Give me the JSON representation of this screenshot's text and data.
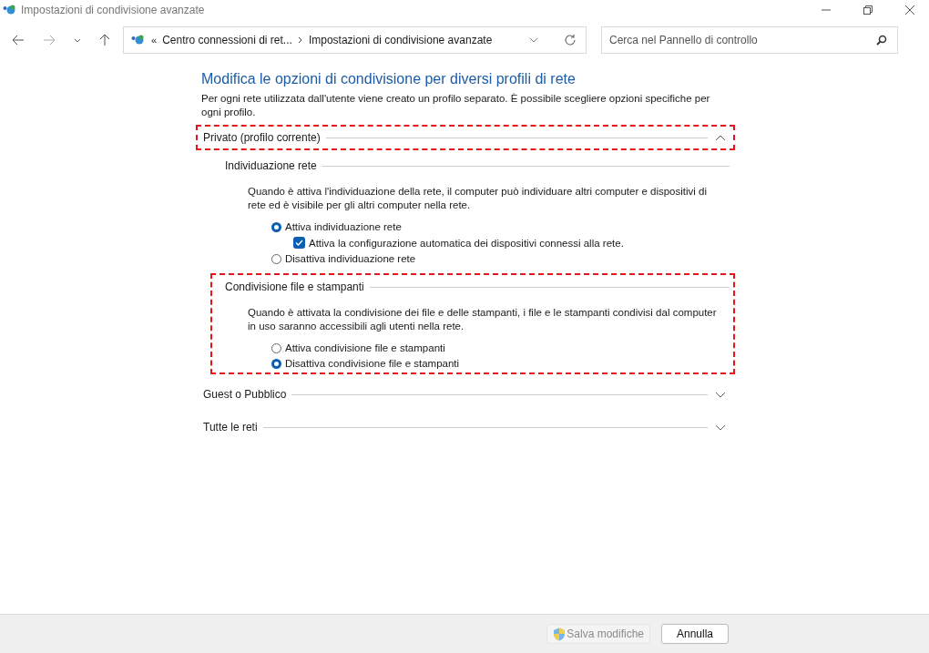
{
  "window": {
    "title": "Impostazioni di condivisione avanzate"
  },
  "address_bar": {
    "overflow": "«",
    "crumbs": [
      "Centro connessioni di ret...",
      "Impostazioni di condivisione avanzate"
    ]
  },
  "search": {
    "placeholder": "Cerca nel Pannello di controllo"
  },
  "heading": "Modifica le opzioni di condivisione per diversi profili di rete",
  "intro": "Per ogni rete utilizzata dall'utente viene creato un profilo separato. È possibile scegliere opzioni specifiche per ogni profilo.",
  "profiles": [
    {
      "title": "Privato (profilo corrente)",
      "expanded": true,
      "highlighted": true,
      "sections": [
        {
          "title": "Individuazione rete",
          "highlighted": false,
          "description": "Quando è attiva l'individuazione della rete, il computer può individuare altri computer e dispositivi di rete ed è visibile per gli altri computer nella rete.",
          "options": [
            {
              "kind": "radio",
              "label": "Attiva individuazione rete",
              "selected": true
            },
            {
              "kind": "checkbox",
              "label": "Attiva la configurazione automatica dei dispositivi connessi alla rete.",
              "checked": true
            },
            {
              "kind": "radio",
              "label": "Disattiva individuazione rete",
              "selected": false
            }
          ]
        },
        {
          "title": "Condivisione file e stampanti",
          "highlighted": true,
          "description": "Quando è attivata la condivisione dei file e delle stampanti, i file e le stampanti condivisi dal computer in uso saranno accessibili agli utenti nella rete.",
          "options": [
            {
              "kind": "radio",
              "label": "Attiva condivisione file e stampanti",
              "selected": false
            },
            {
              "kind": "radio",
              "label": "Disattiva condivisione file e stampanti",
              "selected": true
            }
          ]
        }
      ]
    },
    {
      "title": "Guest o Pubblico",
      "expanded": false,
      "highlighted": false
    },
    {
      "title": "Tutte le reti",
      "expanded": false,
      "highlighted": false
    }
  ],
  "buttons": [
    {
      "label": "Salva modifiche",
      "disabled": true,
      "shield": true
    },
    {
      "label": "Annulla",
      "disabled": false,
      "shield": false
    }
  ]
}
